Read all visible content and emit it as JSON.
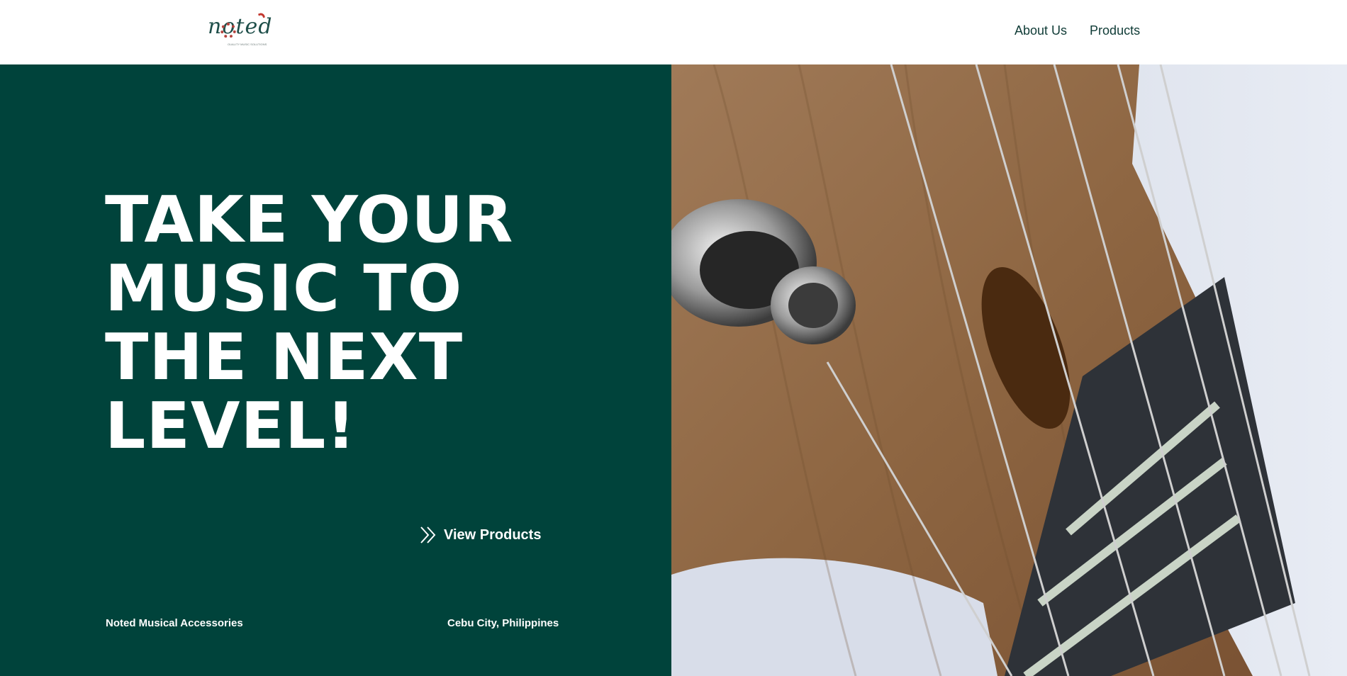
{
  "header": {
    "logo": {
      "text": "noted",
      "tagline": "QUALITY MUSIC SOLUTIONS"
    },
    "nav": [
      {
        "label": "About Us"
      },
      {
        "label": "Products"
      }
    ]
  },
  "hero": {
    "headline_lines": [
      "TAKE YOUR",
      "MUSIC TO",
      "THE NEXT",
      "LEVEL!"
    ],
    "cta": {
      "label": "View Products",
      "icon": "double-chevron-right-icon"
    },
    "footer_left": "Noted Musical Accessories",
    "footer_right": "Cebu City, Philippines",
    "image": {
      "subject": "guitar-headstock-photo"
    }
  },
  "colors": {
    "brand_green": "#00433b",
    "nav_text": "#0f3b36",
    "white": "#ffffff",
    "accent_red": "#c3382f"
  }
}
